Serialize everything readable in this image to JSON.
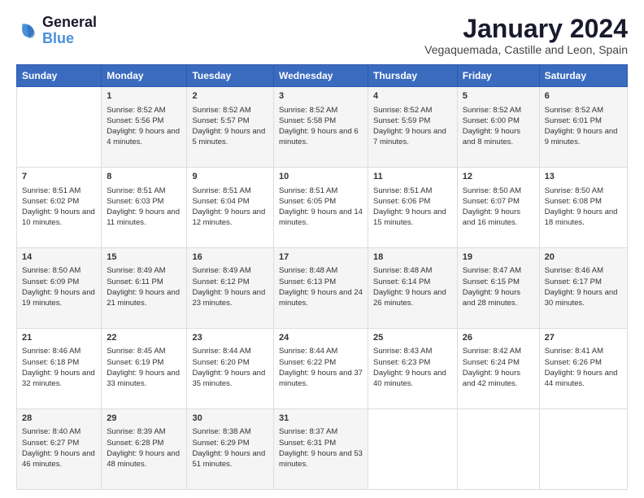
{
  "logo": {
    "line1": "General",
    "line2": "Blue"
  },
  "title": "January 2024",
  "subtitle": "Vegaquemada, Castille and Leon, Spain",
  "days_header": [
    "Sunday",
    "Monday",
    "Tuesday",
    "Wednesday",
    "Thursday",
    "Friday",
    "Saturday"
  ],
  "weeks": [
    [
      {
        "day": "",
        "sunrise": "",
        "sunset": "",
        "daylight": ""
      },
      {
        "day": "1",
        "sunrise": "Sunrise: 8:52 AM",
        "sunset": "Sunset: 5:56 PM",
        "daylight": "Daylight: 9 hours and 4 minutes."
      },
      {
        "day": "2",
        "sunrise": "Sunrise: 8:52 AM",
        "sunset": "Sunset: 5:57 PM",
        "daylight": "Daylight: 9 hours and 5 minutes."
      },
      {
        "day": "3",
        "sunrise": "Sunrise: 8:52 AM",
        "sunset": "Sunset: 5:58 PM",
        "daylight": "Daylight: 9 hours and 6 minutes."
      },
      {
        "day": "4",
        "sunrise": "Sunrise: 8:52 AM",
        "sunset": "Sunset: 5:59 PM",
        "daylight": "Daylight: 9 hours and 7 minutes."
      },
      {
        "day": "5",
        "sunrise": "Sunrise: 8:52 AM",
        "sunset": "Sunset: 6:00 PM",
        "daylight": "Daylight: 9 hours and 8 minutes."
      },
      {
        "day": "6",
        "sunrise": "Sunrise: 8:52 AM",
        "sunset": "Sunset: 6:01 PM",
        "daylight": "Daylight: 9 hours and 9 minutes."
      }
    ],
    [
      {
        "day": "7",
        "sunrise": "Sunrise: 8:51 AM",
        "sunset": "Sunset: 6:02 PM",
        "daylight": "Daylight: 9 hours and 10 minutes."
      },
      {
        "day": "8",
        "sunrise": "Sunrise: 8:51 AM",
        "sunset": "Sunset: 6:03 PM",
        "daylight": "Daylight: 9 hours and 11 minutes."
      },
      {
        "day": "9",
        "sunrise": "Sunrise: 8:51 AM",
        "sunset": "Sunset: 6:04 PM",
        "daylight": "Daylight: 9 hours and 12 minutes."
      },
      {
        "day": "10",
        "sunrise": "Sunrise: 8:51 AM",
        "sunset": "Sunset: 6:05 PM",
        "daylight": "Daylight: 9 hours and 14 minutes."
      },
      {
        "day": "11",
        "sunrise": "Sunrise: 8:51 AM",
        "sunset": "Sunset: 6:06 PM",
        "daylight": "Daylight: 9 hours and 15 minutes."
      },
      {
        "day": "12",
        "sunrise": "Sunrise: 8:50 AM",
        "sunset": "Sunset: 6:07 PM",
        "daylight": "Daylight: 9 hours and 16 minutes."
      },
      {
        "day": "13",
        "sunrise": "Sunrise: 8:50 AM",
        "sunset": "Sunset: 6:08 PM",
        "daylight": "Daylight: 9 hours and 18 minutes."
      }
    ],
    [
      {
        "day": "14",
        "sunrise": "Sunrise: 8:50 AM",
        "sunset": "Sunset: 6:09 PM",
        "daylight": "Daylight: 9 hours and 19 minutes."
      },
      {
        "day": "15",
        "sunrise": "Sunrise: 8:49 AM",
        "sunset": "Sunset: 6:11 PM",
        "daylight": "Daylight: 9 hours and 21 minutes."
      },
      {
        "day": "16",
        "sunrise": "Sunrise: 8:49 AM",
        "sunset": "Sunset: 6:12 PM",
        "daylight": "Daylight: 9 hours and 23 minutes."
      },
      {
        "day": "17",
        "sunrise": "Sunrise: 8:48 AM",
        "sunset": "Sunset: 6:13 PM",
        "daylight": "Daylight: 9 hours and 24 minutes."
      },
      {
        "day": "18",
        "sunrise": "Sunrise: 8:48 AM",
        "sunset": "Sunset: 6:14 PM",
        "daylight": "Daylight: 9 hours and 26 minutes."
      },
      {
        "day": "19",
        "sunrise": "Sunrise: 8:47 AM",
        "sunset": "Sunset: 6:15 PM",
        "daylight": "Daylight: 9 hours and 28 minutes."
      },
      {
        "day": "20",
        "sunrise": "Sunrise: 8:46 AM",
        "sunset": "Sunset: 6:17 PM",
        "daylight": "Daylight: 9 hours and 30 minutes."
      }
    ],
    [
      {
        "day": "21",
        "sunrise": "Sunrise: 8:46 AM",
        "sunset": "Sunset: 6:18 PM",
        "daylight": "Daylight: 9 hours and 32 minutes."
      },
      {
        "day": "22",
        "sunrise": "Sunrise: 8:45 AM",
        "sunset": "Sunset: 6:19 PM",
        "daylight": "Daylight: 9 hours and 33 minutes."
      },
      {
        "day": "23",
        "sunrise": "Sunrise: 8:44 AM",
        "sunset": "Sunset: 6:20 PM",
        "daylight": "Daylight: 9 hours and 35 minutes."
      },
      {
        "day": "24",
        "sunrise": "Sunrise: 8:44 AM",
        "sunset": "Sunset: 6:22 PM",
        "daylight": "Daylight: 9 hours and 37 minutes."
      },
      {
        "day": "25",
        "sunrise": "Sunrise: 8:43 AM",
        "sunset": "Sunset: 6:23 PM",
        "daylight": "Daylight: 9 hours and 40 minutes."
      },
      {
        "day": "26",
        "sunrise": "Sunrise: 8:42 AM",
        "sunset": "Sunset: 6:24 PM",
        "daylight": "Daylight: 9 hours and 42 minutes."
      },
      {
        "day": "27",
        "sunrise": "Sunrise: 8:41 AM",
        "sunset": "Sunset: 6:26 PM",
        "daylight": "Daylight: 9 hours and 44 minutes."
      }
    ],
    [
      {
        "day": "28",
        "sunrise": "Sunrise: 8:40 AM",
        "sunset": "Sunset: 6:27 PM",
        "daylight": "Daylight: 9 hours and 46 minutes."
      },
      {
        "day": "29",
        "sunrise": "Sunrise: 8:39 AM",
        "sunset": "Sunset: 6:28 PM",
        "daylight": "Daylight: 9 hours and 48 minutes."
      },
      {
        "day": "30",
        "sunrise": "Sunrise: 8:38 AM",
        "sunset": "Sunset: 6:29 PM",
        "daylight": "Daylight: 9 hours and 51 minutes."
      },
      {
        "day": "31",
        "sunrise": "Sunrise: 8:37 AM",
        "sunset": "Sunset: 6:31 PM",
        "daylight": "Daylight: 9 hours and 53 minutes."
      },
      {
        "day": "",
        "sunrise": "",
        "sunset": "",
        "daylight": ""
      },
      {
        "day": "",
        "sunrise": "",
        "sunset": "",
        "daylight": ""
      },
      {
        "day": "",
        "sunrise": "",
        "sunset": "",
        "daylight": ""
      }
    ]
  ]
}
